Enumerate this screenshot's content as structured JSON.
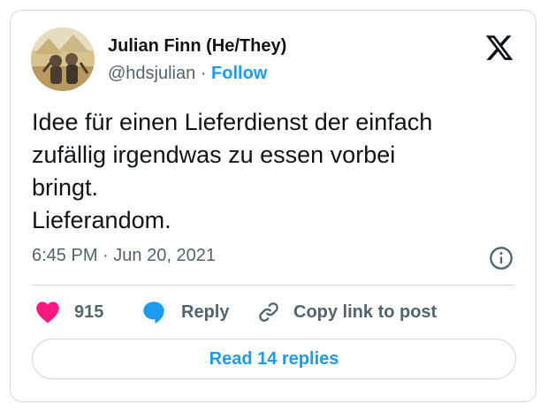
{
  "author": {
    "name": "Julian Finn (He/They)",
    "handle": "@hdsjulian",
    "separator": "·",
    "follow_label": "Follow"
  },
  "tweet": {
    "lines": [
      "Idee für einen Lieferdienst der einfach",
      "zufällig irgendwas zu essen vorbei",
      "bringt.",
      "Lieferandom."
    ],
    "time": "6:45 PM",
    "meta_separator": "·",
    "date": "Jun 20, 2021"
  },
  "actions": {
    "like_count": "915",
    "reply_label": "Reply",
    "copy_label": "Copy link to post"
  },
  "read_replies_label": "Read 14 replies",
  "icons": {
    "brand": "x-logo-icon",
    "info": "info-icon",
    "like": "heart-icon",
    "reply": "speech-bubble-icon",
    "copy": "link-icon"
  },
  "colors": {
    "accent": "#1d9bf0",
    "like": "#f91880",
    "secondary_text": "#536471",
    "border": "#cfd9de"
  }
}
